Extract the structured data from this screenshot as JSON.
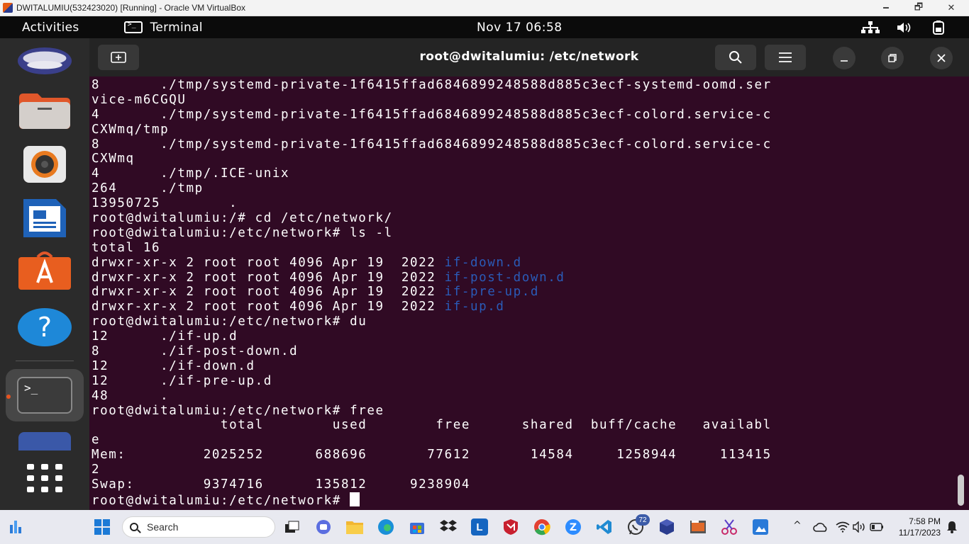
{
  "vbox": {
    "title": "DWITALUMIU(532423020) [Running] - Oracle VM VirtualBox",
    "minimize": "🗕",
    "maximize": "🗗",
    "close": "✕"
  },
  "topbar": {
    "activities": "Activities",
    "app_name": "Terminal",
    "clock": "Nov 17  06:58",
    "tray_icons": [
      "network-icon",
      "volume-icon",
      "battery-icon"
    ]
  },
  "dock": {
    "apps": [
      "avatar-icon",
      "files-icon",
      "rhythmbox-icon",
      "writer-icon",
      "software-store-icon",
      "help-icon",
      "terminal-icon",
      "partial-app-icon",
      "app-grid-icon"
    ],
    "terminal_glyph": ">_"
  },
  "terminal": {
    "title": "root@dwitalumiu: /etc/network",
    "lines": [
      {
        "text": "8       ./tmp/systemd-private-1f6415ffad6846899248588d885c3ecf-systemd-oomd.ser"
      },
      {
        "text": "vice-m6CGQU"
      },
      {
        "text": "4       ./tmp/systemd-private-1f6415ffad6846899248588d885c3ecf-colord.service-c"
      },
      {
        "text": "CXWmq/tmp"
      },
      {
        "text": "8       ./tmp/systemd-private-1f6415ffad6846899248588d885c3ecf-colord.service-c"
      },
      {
        "text": "CXWmq"
      },
      {
        "text": "4       ./tmp/.ICE-unix"
      },
      {
        "text": "264     ./tmp"
      },
      {
        "text": "13950725        ."
      },
      {
        "text": "root@dwitalumiu:/# cd /etc/network/"
      },
      {
        "text": "root@dwitalumiu:/etc/network# ls -l"
      },
      {
        "text": "total 16"
      },
      {
        "text": "drwxr-xr-x 2 root root 4096 Apr 19  2022 ",
        "dir": "if-down.d"
      },
      {
        "text": "drwxr-xr-x 2 root root 4096 Apr 19  2022 ",
        "dir": "if-post-down.d"
      },
      {
        "text": "drwxr-xr-x 2 root root 4096 Apr 19  2022 ",
        "dir": "if-pre-up.d"
      },
      {
        "text": "drwxr-xr-x 2 root root 4096 Apr 19  2022 ",
        "dir": "if-up.d"
      },
      {
        "text": "root@dwitalumiu:/etc/network# du"
      },
      {
        "text": "12      ./if-up.d"
      },
      {
        "text": "8       ./if-post-down.d"
      },
      {
        "text": "12      ./if-down.d"
      },
      {
        "text": "12      ./if-pre-up.d"
      },
      {
        "text": "48      ."
      },
      {
        "text": "root@dwitalumiu:/etc/network# free"
      },
      {
        "text": "               total        used        free      shared  buff/cache   availabl"
      },
      {
        "text": "e"
      },
      {
        "text": "Mem:         2025252      688696       77612       14584     1258944     113415"
      },
      {
        "text": "2"
      },
      {
        "text": "Swap:        9374716      135812     9238904"
      },
      {
        "text": "root@dwitalumiu:/etc/network# ",
        "cursor": true
      }
    ]
  },
  "taskbar": {
    "search_placeholder": "Search",
    "whatsapp_badge": "72",
    "time": "7:58 PM",
    "date": "11/17/2023",
    "chevron": "^"
  }
}
